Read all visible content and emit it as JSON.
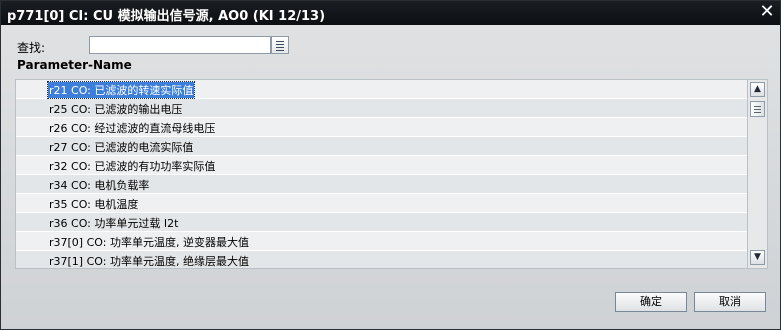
{
  "window": {
    "title": "p771[0] CI: CU 模拟输出信号源, AO0 (KI 12/13)",
    "close_glyph": "✕"
  },
  "search": {
    "label": "查找:",
    "value": "",
    "placeholder": ""
  },
  "list": {
    "column_header": "Parameter-Name",
    "selected_index": 0,
    "items": [
      "r21 CO: 已滤波的转速实际值",
      "r25 CO: 已滤波的输出电压",
      "r26 CO: 经过滤波的直流母线电压",
      "r27 CO: 已滤波的电流实际值",
      "r32 CO: 已滤波的有功功率实际值",
      "r34 CO: 电机负载率",
      "r35 CO: 电机温度",
      "r36 CO: 功率单元过载 I2t",
      "r37[0] CO: 功率单元温度, 逆变器最大值",
      "r37[1] CO: 功率单元温度, 绝缘层最大值"
    ]
  },
  "buttons": {
    "ok_label": "确定",
    "cancel_label": "取消"
  },
  "colors": {
    "title_bar": "#0c0f12",
    "selection": "#3d7fd8",
    "dialog_bg": "#d6d8da"
  },
  "icons": {
    "close": "close-icon",
    "search_options": "list-icon",
    "scroll_up": "chevron-up-icon",
    "scroll_down": "chevron-down-icon"
  }
}
